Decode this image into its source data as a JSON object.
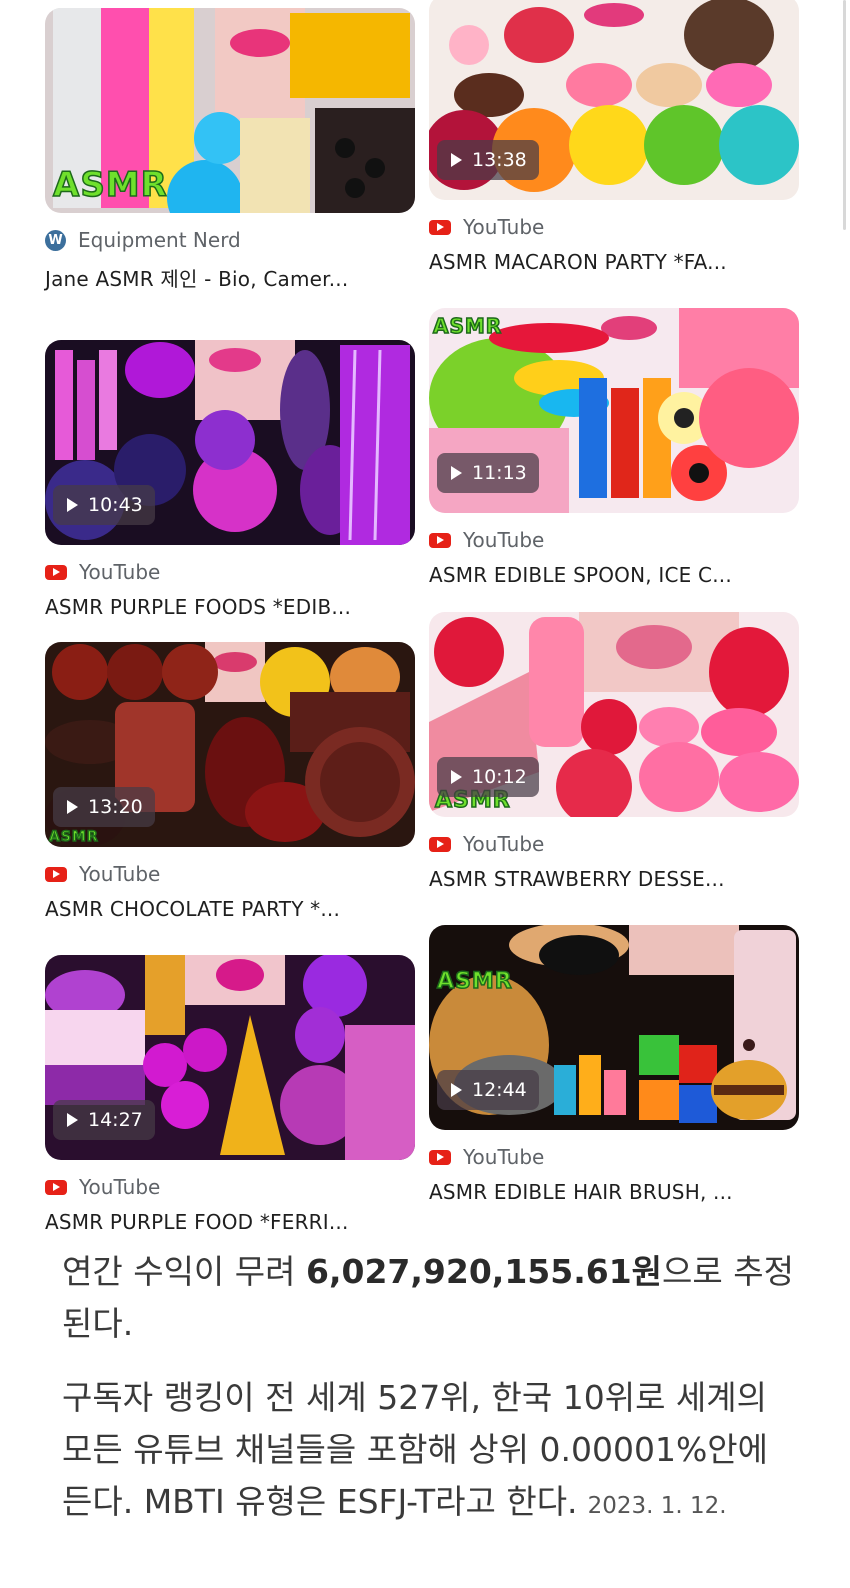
{
  "cards": [
    {
      "source": "Equipment Nerd",
      "source_icon": "wordpress-icon",
      "title": "Jane ASMR 제인 - Bio, Camer...",
      "duration": "",
      "asmr_label": "ASMR"
    },
    {
      "source": "YouTube",
      "source_icon": "youtube-icon",
      "title": "ASMR MACARON PARTY *FA...",
      "duration": "13:38"
    },
    {
      "source": "YouTube",
      "source_icon": "youtube-icon",
      "title": "ASMR PURPLE FOODS *EDIB...",
      "duration": "10:43"
    },
    {
      "source": "YouTube",
      "source_icon": "youtube-icon",
      "title": "ASMR EDIBLE SPOON, ICE C...",
      "duration": "11:13",
      "asmr_label": "ASMR"
    },
    {
      "source": "YouTube",
      "source_icon": "youtube-icon",
      "title": "ASMR CHOCOLATE PARTY *...",
      "duration": "13:20",
      "asmr_label": "ASMR"
    },
    {
      "source": "YouTube",
      "source_icon": "youtube-icon",
      "title": "ASMR STRAWBERRY DESSE...",
      "duration": "10:12",
      "asmr_label": "ASMR"
    },
    {
      "source": "YouTube",
      "source_icon": "youtube-icon",
      "title": "ASMR PURPLE FOOD *FERRI...",
      "duration": "14:27"
    },
    {
      "source": "YouTube",
      "source_icon": "youtube-icon",
      "title": "ASMR EDIBLE HAIR BRUSH, ...",
      "duration": "12:44",
      "asmr_label": "ASMR"
    }
  ],
  "article": {
    "p1_before": "연간 수익이 무려 ",
    "p1_bold": "6,027,920,155.61원",
    "p1_after": "으로 추정된다.",
    "p2": "구독자 랭킹이 전 세계 527위, 한국 10위로 세계의 모든 유튜브 채널들을 포함해 상위 0.00001%안에 든다. MBTI 유형은 ESFJ-T라고 한다.",
    "date": "2023. 1. 12."
  },
  "colors": {
    "youtube_red": "#e62117",
    "asmr_green": "#6fe02c",
    "badge_bg": "#463c46"
  }
}
